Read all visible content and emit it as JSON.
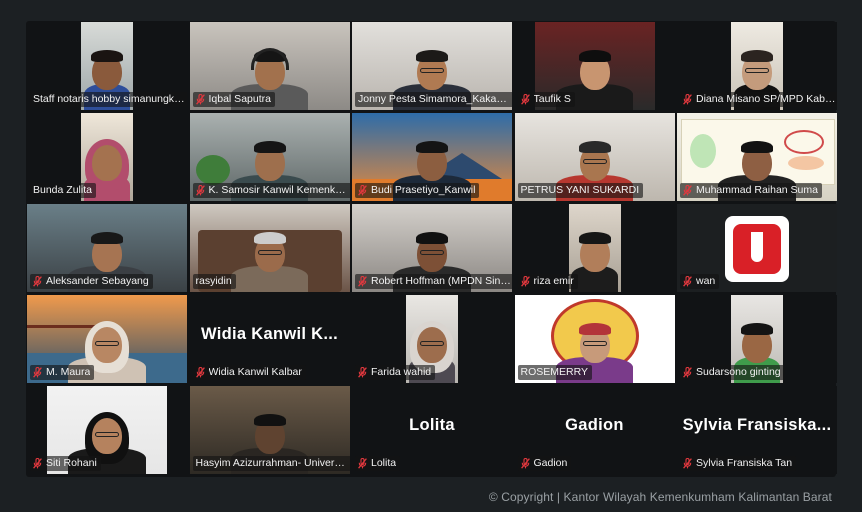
{
  "meeting": {
    "participants": [
      {
        "name": "Staff notaris hobby simanungkalit",
        "mic_muted": false,
        "video": true
      },
      {
        "name": "Iqbal Saputra",
        "mic_muted": true,
        "video": true
      },
      {
        "name": "Jonny Pesta Simamora_Kakanwil Kalbar",
        "mic_muted": false,
        "video": true,
        "speaking": true
      },
      {
        "name": "Taufik S",
        "mic_muted": true,
        "video": true
      },
      {
        "name": "Diana Misano SP/MPD Kab Kubu Raya",
        "mic_muted": true,
        "video": true
      },
      {
        "name": "Bunda Zulita",
        "mic_muted": false,
        "video": true
      },
      {
        "name": "K. Samosir Kanwil Kemenkumham Kalbar",
        "mic_muted": true,
        "video": true
      },
      {
        "name": "Budi Prasetiyo_Kanwil",
        "mic_muted": true,
        "video": true
      },
      {
        "name": "PETRUS YANI SUKARDI",
        "mic_muted": false,
        "video": true
      },
      {
        "name": "Muhammad Raihan Suma",
        "mic_muted": true,
        "video": true
      },
      {
        "name": "Aleksander Sebayang",
        "mic_muted": true,
        "video": true
      },
      {
        "name": "rasyidin",
        "mic_muted": false,
        "video": true
      },
      {
        "name": "Robert Hoffman (MPDN Sintang)",
        "mic_muted": true,
        "video": true
      },
      {
        "name": "riza emir",
        "mic_muted": true,
        "video": true
      },
      {
        "name": "wan",
        "mic_muted": true,
        "video": true
      },
      {
        "name": "M. Maura",
        "mic_muted": true,
        "video": true
      },
      {
        "name": "Widia Kanwil Kalbar",
        "mic_muted": true,
        "video": false,
        "display_name": "Widia Kanwil K..."
      },
      {
        "name": "Farida wahid",
        "mic_muted": true,
        "video": true
      },
      {
        "name": "ROSEMERRY",
        "mic_muted": false,
        "video": true
      },
      {
        "name": "Sudarsono ginting",
        "mic_muted": true,
        "video": true
      },
      {
        "name": "Siti Rohani",
        "mic_muted": true,
        "video": true
      },
      {
        "name": "Hasyim Azizurrahman- Universitas Tanjungpura",
        "mic_muted": false,
        "video": true
      },
      {
        "name": "Lolita",
        "mic_muted": true,
        "video": false,
        "display_name": "Lolita"
      },
      {
        "name": "Gadion",
        "mic_muted": true,
        "video": false,
        "display_name": "Gadion"
      },
      {
        "name": "Sylvia Fransiska Tan",
        "mic_muted": true,
        "video": false,
        "display_name": "Sylvia  Fransiska..."
      }
    ]
  },
  "footer": {
    "copyright": "© Copyright | Kantor Wilayah Kemenkumham Kalimantan Barat"
  },
  "colors": {
    "active_speaker_border": "#23d959",
    "muted_icon": "#e0383e",
    "background": "#1c2023"
  },
  "icons": {
    "muted": "mic-muted-icon"
  }
}
